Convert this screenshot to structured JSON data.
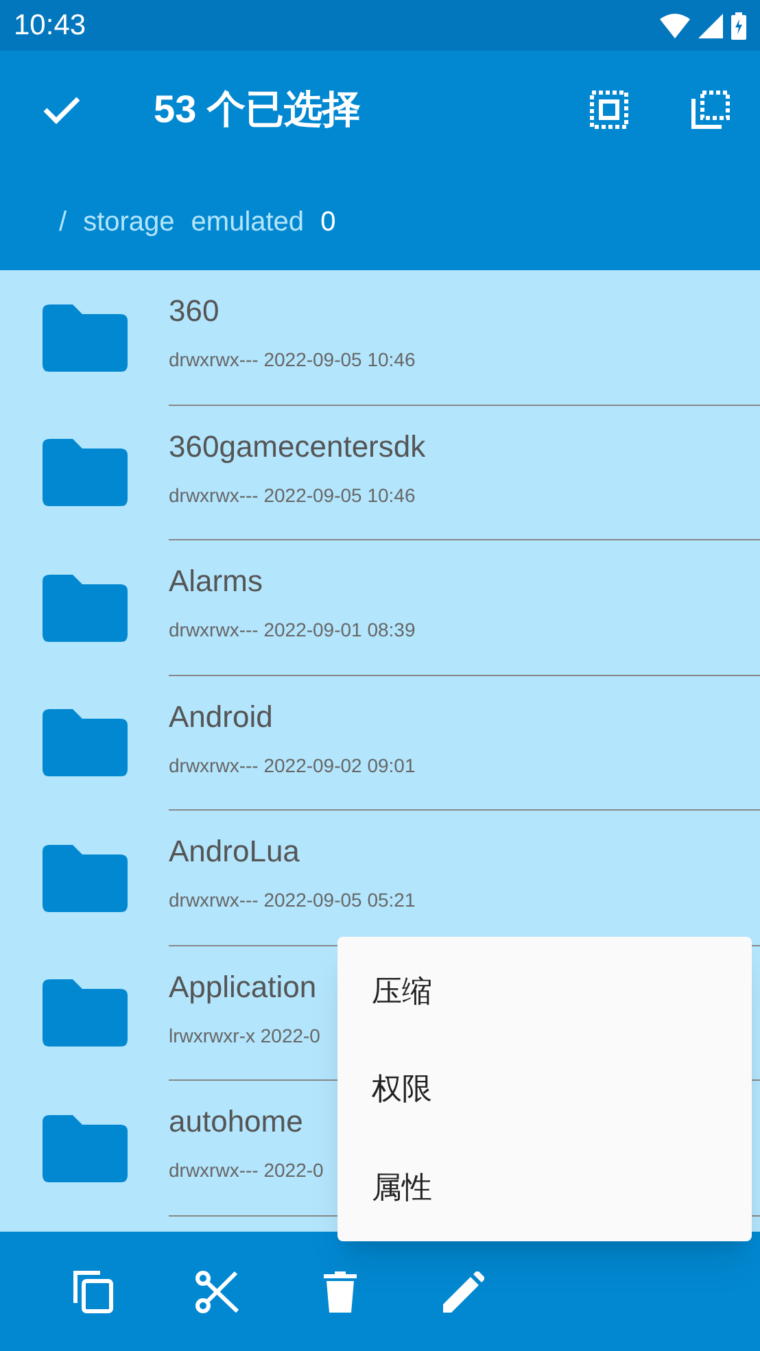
{
  "status_bar": {
    "time": "10:43"
  },
  "action_bar": {
    "title": "53 个已选择"
  },
  "breadcrumb": [
    {
      "label": "/",
      "current": false
    },
    {
      "label": "storage",
      "current": false
    },
    {
      "label": "emulated",
      "current": false
    },
    {
      "label": "0",
      "current": true
    }
  ],
  "files": [
    {
      "name": "360",
      "meta": "drwxrwx--- 2022-09-05 10:46",
      "selected": true
    },
    {
      "name": "360gamecentersdk",
      "meta": "drwxrwx--- 2022-09-05 10:46",
      "selected": true
    },
    {
      "name": "Alarms",
      "meta": "drwxrwx--- 2022-09-01 08:39",
      "selected": true
    },
    {
      "name": "Android",
      "meta": "drwxrwx--- 2022-09-02 09:01",
      "selected": true
    },
    {
      "name": "AndroLua",
      "meta": "drwxrwx--- 2022-09-05 05:21",
      "selected": true
    },
    {
      "name": "Application",
      "meta": "lrwxrwxr-x 2022-0",
      "selected": true
    },
    {
      "name": "autohome",
      "meta": "drwxrwx--- 2022-0",
      "selected": true
    }
  ],
  "menu": [
    {
      "label": "压缩"
    },
    {
      "label": "权限"
    },
    {
      "label": "属性"
    }
  ]
}
